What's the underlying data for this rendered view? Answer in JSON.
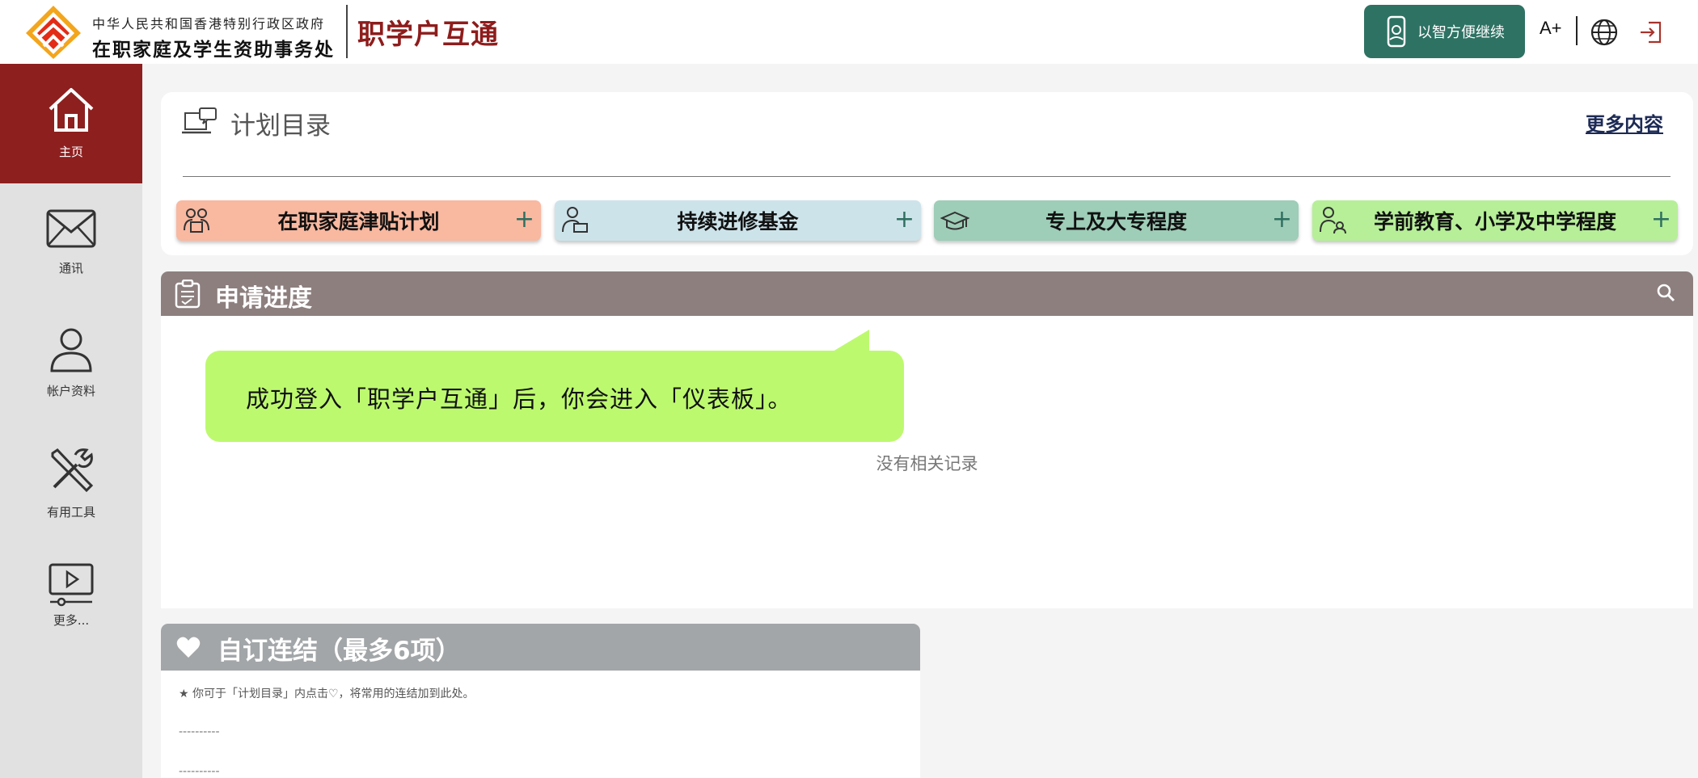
{
  "header": {
    "org_top": "中华人民共和国香港特别行政区政府",
    "org_main": "在职家庭及学生资助事务处",
    "brand": "职学户互通",
    "smart_btn_label": "以智方便继续",
    "font_size_label": "A+",
    "icons": [
      "logo-icon",
      "phone-icon",
      "globe-icon",
      "logout-icon"
    ]
  },
  "sidebar": {
    "items": [
      {
        "label": "主页",
        "icon": "home-icon",
        "active": true
      },
      {
        "label": "通讯",
        "icon": "mail-icon"
      },
      {
        "label": "帐户资料",
        "icon": "user-icon"
      },
      {
        "label": "有用工具",
        "icon": "tools-icon"
      },
      {
        "label": "更多...",
        "icon": "video-icon"
      }
    ]
  },
  "plan_catalog": {
    "title": "计划目录",
    "more_label": "更多内容",
    "plans": [
      {
        "label": "在职家庭津贴计划",
        "color": "#f9b8a0",
        "icon": "family-icon"
      },
      {
        "label": "持续进修基金",
        "color": "#cde3ea",
        "icon": "learner-icon"
      },
      {
        "label": "专上及大专程度",
        "color": "#9ecdb8",
        "icon": "graduation-cap-icon"
      },
      {
        "label": "学前教育、小学及中学程度",
        "color": "#b6ef98",
        "icon": "parent-child-icon"
      }
    ],
    "plus": "+"
  },
  "progress": {
    "title": "申请进度",
    "empty_text": "没有相关记录",
    "header_color": "#8e7f7f"
  },
  "tooltip": {
    "text": "成功登入「职学户互通」后，你会进入「仪表板」。",
    "color": "#bdf96f"
  },
  "custom_links": {
    "title": "自订连结（最多6项）",
    "note": "★ 你可于「计划目录」内点击♡，将常用的连结加到此处。",
    "placeholders": [
      "----------",
      "----------"
    ]
  },
  "colors": {
    "brand_red": "#8e1c1c",
    "smart_green": "#2e7263",
    "sidebar_active": "#8e1f1f",
    "sidebar_bg": "#e1e1e1"
  }
}
